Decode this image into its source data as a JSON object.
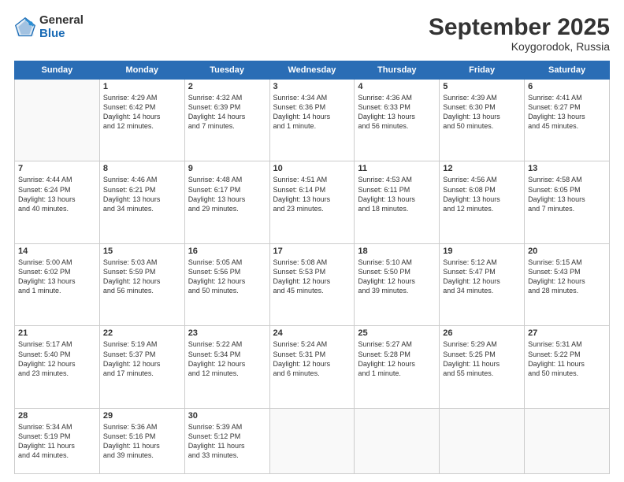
{
  "logo": {
    "general": "General",
    "blue": "Blue"
  },
  "header": {
    "month": "September 2025",
    "location": "Koygorodok, Russia"
  },
  "days_of_week": [
    "Sunday",
    "Monday",
    "Tuesday",
    "Wednesday",
    "Thursday",
    "Friday",
    "Saturday"
  ],
  "weeks": [
    [
      {
        "day": "",
        "info": ""
      },
      {
        "day": "1",
        "info": "Sunrise: 4:29 AM\nSunset: 6:42 PM\nDaylight: 14 hours\nand 12 minutes."
      },
      {
        "day": "2",
        "info": "Sunrise: 4:32 AM\nSunset: 6:39 PM\nDaylight: 14 hours\nand 7 minutes."
      },
      {
        "day": "3",
        "info": "Sunrise: 4:34 AM\nSunset: 6:36 PM\nDaylight: 14 hours\nand 1 minute."
      },
      {
        "day": "4",
        "info": "Sunrise: 4:36 AM\nSunset: 6:33 PM\nDaylight: 13 hours\nand 56 minutes."
      },
      {
        "day": "5",
        "info": "Sunrise: 4:39 AM\nSunset: 6:30 PM\nDaylight: 13 hours\nand 50 minutes."
      },
      {
        "day": "6",
        "info": "Sunrise: 4:41 AM\nSunset: 6:27 PM\nDaylight: 13 hours\nand 45 minutes."
      }
    ],
    [
      {
        "day": "7",
        "info": "Sunrise: 4:44 AM\nSunset: 6:24 PM\nDaylight: 13 hours\nand 40 minutes."
      },
      {
        "day": "8",
        "info": "Sunrise: 4:46 AM\nSunset: 6:21 PM\nDaylight: 13 hours\nand 34 minutes."
      },
      {
        "day": "9",
        "info": "Sunrise: 4:48 AM\nSunset: 6:17 PM\nDaylight: 13 hours\nand 29 minutes."
      },
      {
        "day": "10",
        "info": "Sunrise: 4:51 AM\nSunset: 6:14 PM\nDaylight: 13 hours\nand 23 minutes."
      },
      {
        "day": "11",
        "info": "Sunrise: 4:53 AM\nSunset: 6:11 PM\nDaylight: 13 hours\nand 18 minutes."
      },
      {
        "day": "12",
        "info": "Sunrise: 4:56 AM\nSunset: 6:08 PM\nDaylight: 13 hours\nand 12 minutes."
      },
      {
        "day": "13",
        "info": "Sunrise: 4:58 AM\nSunset: 6:05 PM\nDaylight: 13 hours\nand 7 minutes."
      }
    ],
    [
      {
        "day": "14",
        "info": "Sunrise: 5:00 AM\nSunset: 6:02 PM\nDaylight: 13 hours\nand 1 minute."
      },
      {
        "day": "15",
        "info": "Sunrise: 5:03 AM\nSunset: 5:59 PM\nDaylight: 12 hours\nand 56 minutes."
      },
      {
        "day": "16",
        "info": "Sunrise: 5:05 AM\nSunset: 5:56 PM\nDaylight: 12 hours\nand 50 minutes."
      },
      {
        "day": "17",
        "info": "Sunrise: 5:08 AM\nSunset: 5:53 PM\nDaylight: 12 hours\nand 45 minutes."
      },
      {
        "day": "18",
        "info": "Sunrise: 5:10 AM\nSunset: 5:50 PM\nDaylight: 12 hours\nand 39 minutes."
      },
      {
        "day": "19",
        "info": "Sunrise: 5:12 AM\nSunset: 5:47 PM\nDaylight: 12 hours\nand 34 minutes."
      },
      {
        "day": "20",
        "info": "Sunrise: 5:15 AM\nSunset: 5:43 PM\nDaylight: 12 hours\nand 28 minutes."
      }
    ],
    [
      {
        "day": "21",
        "info": "Sunrise: 5:17 AM\nSunset: 5:40 PM\nDaylight: 12 hours\nand 23 minutes."
      },
      {
        "day": "22",
        "info": "Sunrise: 5:19 AM\nSunset: 5:37 PM\nDaylight: 12 hours\nand 17 minutes."
      },
      {
        "day": "23",
        "info": "Sunrise: 5:22 AM\nSunset: 5:34 PM\nDaylight: 12 hours\nand 12 minutes."
      },
      {
        "day": "24",
        "info": "Sunrise: 5:24 AM\nSunset: 5:31 PM\nDaylight: 12 hours\nand 6 minutes."
      },
      {
        "day": "25",
        "info": "Sunrise: 5:27 AM\nSunset: 5:28 PM\nDaylight: 12 hours\nand 1 minute."
      },
      {
        "day": "26",
        "info": "Sunrise: 5:29 AM\nSunset: 5:25 PM\nDaylight: 11 hours\nand 55 minutes."
      },
      {
        "day": "27",
        "info": "Sunrise: 5:31 AM\nSunset: 5:22 PM\nDaylight: 11 hours\nand 50 minutes."
      }
    ],
    [
      {
        "day": "28",
        "info": "Sunrise: 5:34 AM\nSunset: 5:19 PM\nDaylight: 11 hours\nand 44 minutes."
      },
      {
        "day": "29",
        "info": "Sunrise: 5:36 AM\nSunset: 5:16 PM\nDaylight: 11 hours\nand 39 minutes."
      },
      {
        "day": "30",
        "info": "Sunrise: 5:39 AM\nSunset: 5:12 PM\nDaylight: 11 hours\nand 33 minutes."
      },
      {
        "day": "",
        "info": ""
      },
      {
        "day": "",
        "info": ""
      },
      {
        "day": "",
        "info": ""
      },
      {
        "day": "",
        "info": ""
      }
    ]
  ]
}
